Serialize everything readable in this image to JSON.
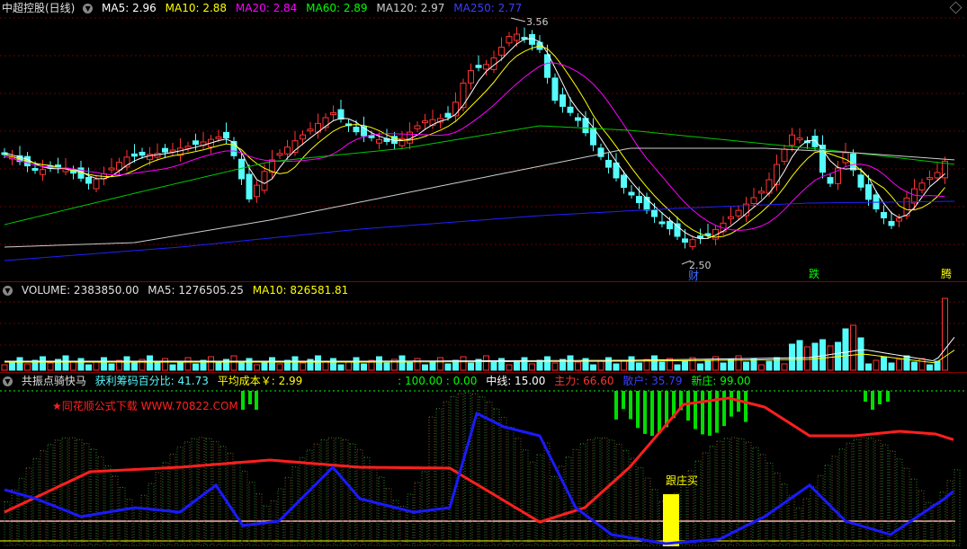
{
  "kline_panel": {
    "title": "中超控股(日线)",
    "indicators": [
      {
        "label": "MA5: 2.96",
        "color": "#ffffff"
      },
      {
        "label": "MA10: 2.88",
        "color": "#ffff00"
      },
      {
        "label": "MA20: 2.84",
        "color": "#ff00ff"
      },
      {
        "label": "MA60: 2.89",
        "color": "#00ff00"
      },
      {
        "label": "MA120: 2.97",
        "color": "#cccccc"
      },
      {
        "label": "MA250: 2.77",
        "color": "#0000ff"
      }
    ],
    "high_label": "3.56",
    "low_label": "2.50",
    "markers": [
      {
        "text": "财",
        "color": "#3c6cff"
      },
      {
        "text": "跌",
        "color": "#00ff00"
      },
      {
        "text": "腾",
        "color": "#ffff00"
      }
    ]
  },
  "volume_panel": {
    "title": "VOLUME: 2383850.00",
    "ma5": "MA5: 1276505.25",
    "ma10": "MA10: 826581.81"
  },
  "indicator_panel": {
    "title": "共振点骑快马",
    "profit_pct": "获利筹码百分比: 41.73",
    "avg_cost": "平均成本￥: 2.99",
    "vals": ": 100.00 : 0.00",
    "mid": "中线: 15.00",
    "main_force": "主力: 66.60",
    "retail": "散户: 35.79",
    "new_dealer": "新庄: 99.00",
    "watermark": "★同花顺公式下载 WWW.70822.COM",
    "buy_signal": "跟庄买"
  },
  "colors": {
    "up": "#ff3232",
    "down": "#54fcfc",
    "grid": "#8a0000"
  }
}
